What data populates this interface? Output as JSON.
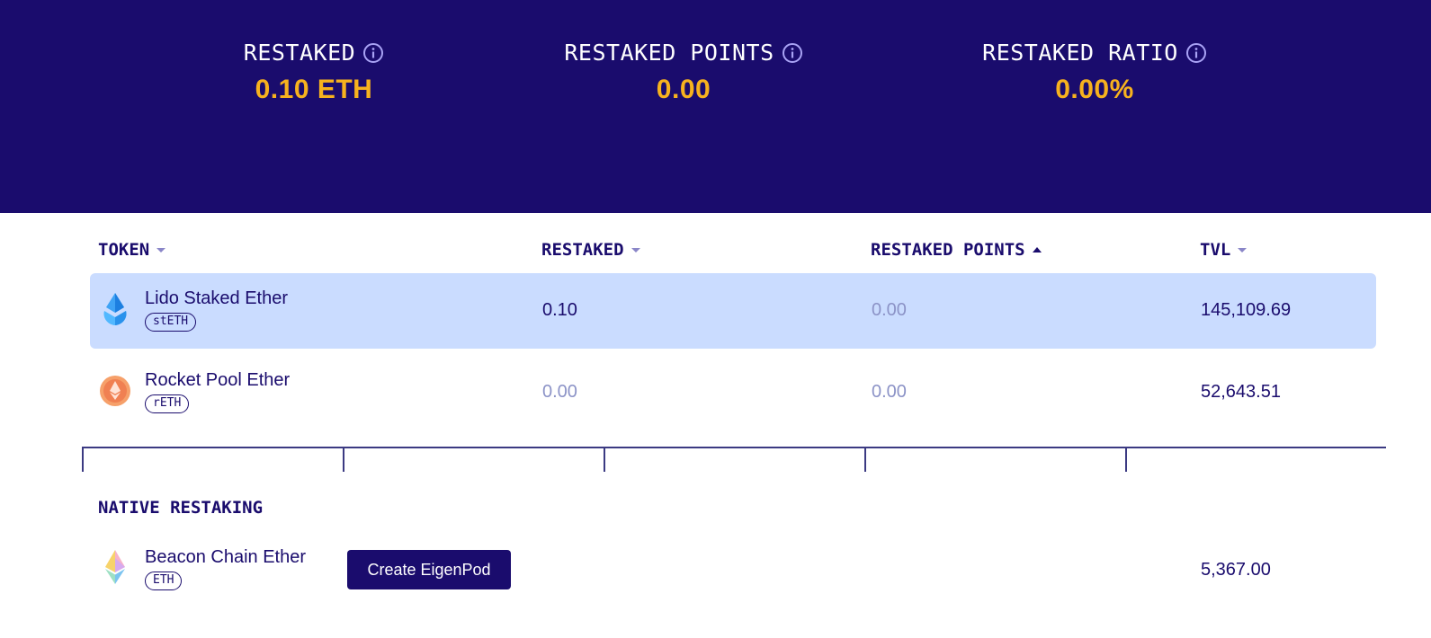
{
  "stats": [
    {
      "label": "RESTAKED",
      "value": "0.10 ETH"
    },
    {
      "label": "RESTAKED POINTS",
      "value": "0.00"
    },
    {
      "label": "RESTAKED RATIO",
      "value": "0.00%"
    }
  ],
  "table": {
    "headers": {
      "token": "TOKEN",
      "restaked": "RESTAKED",
      "restaked_points": "RESTAKED POINTS",
      "tvl": "TVL"
    },
    "sort": {
      "column": "restaked_points",
      "direction": "ascending"
    },
    "rows": [
      {
        "name": "Lido Staked Ether",
        "symbol": "stETH",
        "icon": "lido-icon",
        "restaked": "0.10",
        "restaked_points": "0.00",
        "tvl": "145,109.69"
      },
      {
        "name": "Rocket Pool Ether",
        "symbol": "rETH",
        "icon": "rocket-pool-icon",
        "restaked": "0.00",
        "restaked_points": "0.00",
        "tvl": "52,643.51"
      }
    ]
  },
  "native": {
    "title": "NATIVE RESTAKING",
    "row": {
      "name": "Beacon Chain Ether",
      "symbol": "ETH",
      "icon": "ethereum-icon",
      "button_label": "Create EigenPod",
      "tvl": "5,367.00"
    }
  },
  "colors": {
    "hero_background": "#1a0c6d",
    "accent": "#f7b21e",
    "row_highlight": "#cadcff",
    "muted_text": "#8c93c7",
    "info_icon": "#a9a3f5"
  }
}
